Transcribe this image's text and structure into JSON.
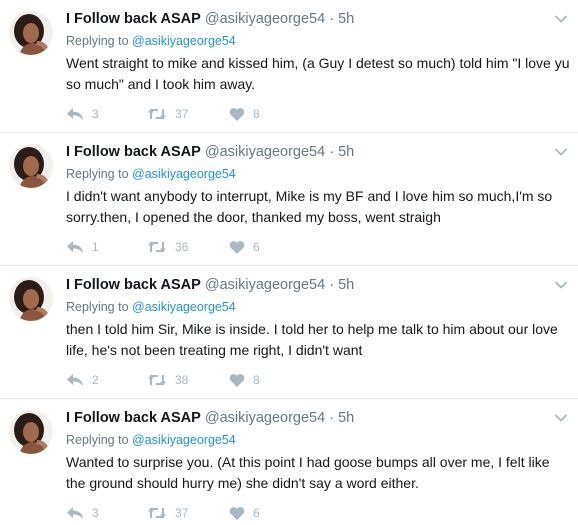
{
  "colors": {
    "name": "#14171a",
    "meta": "#657786",
    "mention": "#1b95e0",
    "icon": "#aab8c2",
    "divider": "#e6ecf0"
  },
  "tweets": [
    {
      "name": "I Follow back ASAP",
      "handle": "@asikiyageorge54",
      "separator": "·",
      "time": "5h",
      "replying_prefix": "Replying to",
      "replying_to": "@asikiyageorge54",
      "text": "Went straight to mike and kissed him, (a Guy I detest so much) told him \"I love yu so much\" and I took him away.",
      "replies": "3",
      "retweets": "37",
      "likes": "8"
    },
    {
      "name": "I Follow back ASAP",
      "handle": "@asikiyageorge54",
      "separator": "·",
      "time": "5h",
      "replying_prefix": "Replying to",
      "replying_to": "@asikiyageorge54",
      "text": "I didn't want anybody to interrupt, Mike is my BF and I love him so much,I'm so sorry.then, I opened the door, thanked my boss, went straigh",
      "replies": "1",
      "retweets": "36",
      "likes": "6"
    },
    {
      "name": "I Follow back ASAP",
      "handle": "@asikiyageorge54",
      "separator": "·",
      "time": "5h",
      "replying_prefix": "Replying to",
      "replying_to": "@asikiyageorge54",
      "text": "then I told him Sir, Mike is inside. I told her to help me talk to him about our love life, he's not been treating me right, I didn't want",
      "replies": "2",
      "retweets": "38",
      "likes": "8"
    },
    {
      "name": "I Follow back ASAP",
      "handle": "@asikiyageorge54",
      "separator": "·",
      "time": "5h",
      "replying_prefix": "Replying to",
      "replying_to": "@asikiyageorge54",
      "text": "Wanted to surprise you. (At this point I had goose bumps all over me, I felt like the ground should hurry me) she didn't say a word either.",
      "replies": "3",
      "retweets": "37",
      "likes": "6"
    }
  ],
  "icons": {
    "avatar": "user-avatar",
    "menu": "chevron-down-icon",
    "reply": "reply-icon",
    "retweet": "retweet-icon",
    "like": "heart-icon"
  }
}
